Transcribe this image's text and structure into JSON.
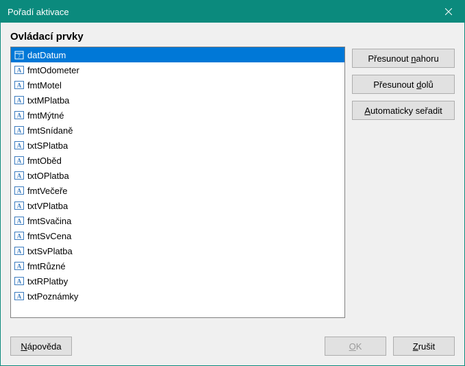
{
  "window": {
    "title": "Pořadí aktivace"
  },
  "group_label": "Ovládací prvky",
  "list": {
    "items": [
      {
        "label": "datDatum",
        "icon": "date",
        "selected": true
      },
      {
        "label": "fmtOdometer",
        "icon": "text",
        "selected": false
      },
      {
        "label": "fmtMotel",
        "icon": "text",
        "selected": false
      },
      {
        "label": "txtMPlatba",
        "icon": "text",
        "selected": false
      },
      {
        "label": "fmtMýtné",
        "icon": "text",
        "selected": false
      },
      {
        "label": "fmtSnídaně",
        "icon": "text",
        "selected": false
      },
      {
        "label": "txtSPlatba",
        "icon": "text",
        "selected": false
      },
      {
        "label": "fmtOběd",
        "icon": "text",
        "selected": false
      },
      {
        "label": "txtOPlatba",
        "icon": "text",
        "selected": false
      },
      {
        "label": "fmtVečeře",
        "icon": "text",
        "selected": false
      },
      {
        "label": "txtVPlatba",
        "icon": "text",
        "selected": false
      },
      {
        "label": "fmtSvačina",
        "icon": "text",
        "selected": false
      },
      {
        "label": "fmtSvCena",
        "icon": "text",
        "selected": false
      },
      {
        "label": "txtSvPlatba",
        "icon": "text",
        "selected": false
      },
      {
        "label": "fmtRůzné",
        "icon": "text",
        "selected": false
      },
      {
        "label": "txtRPlatby",
        "icon": "text",
        "selected": false
      },
      {
        "label": "txtPoznámky",
        "icon": "text",
        "selected": false
      }
    ]
  },
  "buttons": {
    "move_up_pre": "Přesunout ",
    "move_up_u": "n",
    "move_up_post": "ahoru",
    "move_down_pre": "Přesunout ",
    "move_down_u": "d",
    "move_down_post": "olů",
    "auto_sort_u": "A",
    "auto_sort_post": "utomaticky seřadit",
    "help_u": "N",
    "help_post": "ápověda",
    "ok_u": "O",
    "ok_post": "K",
    "cancel_u": "Z",
    "cancel_post": "rušit"
  }
}
